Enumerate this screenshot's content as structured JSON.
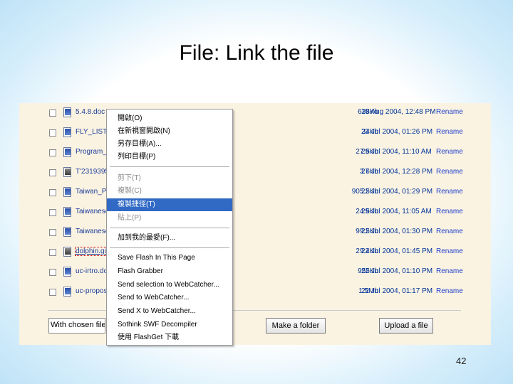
{
  "slide": {
    "title": "File: Link the file",
    "page_number": "42"
  },
  "files": [
    {
      "name": "5.4.8.doc",
      "size": "638Kb",
      "date": "19 Aug 2004, 12:48 PM",
      "icon": "word-doc-icon"
    },
    {
      "name": "FLY_LIST.",
      "size": "34Kb",
      "date": "22 Jul 2004, 01:26 PM",
      "icon": "word-doc-icon"
    },
    {
      "name": "Program_E",
      "size": "27.5Kb",
      "date": "29 Jul 2004, 11:10 AM",
      "icon": "word-doc-icon"
    },
    {
      "name": "T'2319395",
      "size": "3.6Kb",
      "date": "27 Jul 2004, 12:28 PM",
      "icon": "image-icon"
    },
    {
      "name": "Taiwan_Pl",
      "size": "905.5Kb",
      "date": "22 Jul 2004, 01:29 PM",
      "icon": "word-doc-icon"
    },
    {
      "name": "Taiwanese",
      "size": "24.5Kb",
      "date": "29 Jul 2004, 11:05 AM",
      "icon": "word-doc-icon"
    },
    {
      "name": "Taiwanese",
      "size": "99.5Kb",
      "date": "22 Jul 2004, 01:30 PM",
      "icon": "word-doc-icon"
    },
    {
      "name": "dolphin.gif",
      "size": "29.4Kb",
      "date": "22 Jul 2004, 01:45 PM",
      "icon": "image-icon"
    },
    {
      "name": "uc-irtro.do",
      "size": "955Kb",
      "date": "22 Jul 2004, 01:10 PM",
      "icon": "word-doc-icon"
    },
    {
      "name": "uc-propos",
      "size": "1.5Mb",
      "date": "22 Jul 2004, 01:17 PM",
      "icon": "word-doc-icon"
    }
  ],
  "rename_label": "Rename",
  "controls": {
    "with_chosen": "With chosen files ...",
    "make_folder": "Make a folder",
    "upload_file": "Upload a file"
  },
  "context_menu": {
    "items": [
      {
        "label": "開啟(O)",
        "state": "normal"
      },
      {
        "label": "在新視窗開啟(N)",
        "state": "normal"
      },
      {
        "label": "另存目標(A)...",
        "state": "normal"
      },
      {
        "label": "列印目標(P)",
        "state": "normal"
      },
      {
        "label": "剪下(T)",
        "state": "disabled"
      },
      {
        "label": "複製(C)",
        "state": "disabled"
      },
      {
        "label": "複製捷徑(T)",
        "state": "highlighted"
      },
      {
        "label": "貼上(P)",
        "state": "disabled"
      },
      {
        "label": "加到我的最愛(F)...",
        "state": "normal"
      },
      {
        "label": "Save Flash In This Page",
        "state": "normal"
      },
      {
        "label": "Flash Grabber",
        "state": "normal"
      },
      {
        "label": "Send selection to WebCatcher...",
        "state": "normal"
      },
      {
        "label": "Send to WebCatcher...",
        "state": "normal"
      },
      {
        "label": "Send X to WebCatcher...",
        "state": "normal"
      },
      {
        "label": "Sothink SWF Decompiler",
        "state": "normal"
      },
      {
        "label": "使用 FlashGet 下載",
        "state": "normal"
      }
    ]
  },
  "colors": {
    "panel_bg": "#faf3e2",
    "link": "#1c3c99",
    "highlight": "#316ac5"
  }
}
